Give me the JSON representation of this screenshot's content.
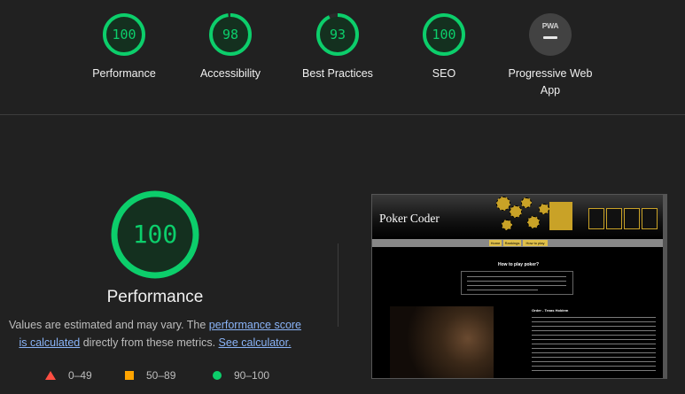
{
  "top_scores": [
    {
      "score": "100",
      "label": "Performance",
      "fraction": 1.0,
      "color": "#0cce6b"
    },
    {
      "score": "98",
      "label": "Accessibility",
      "fraction": 0.98,
      "color": "#0cce6b"
    },
    {
      "score": "93",
      "label": "Best Practices",
      "fraction": 0.93,
      "color": "#0cce6b"
    },
    {
      "score": "100",
      "label": "SEO",
      "fraction": 1.0,
      "color": "#0cce6b"
    }
  ],
  "pwa": {
    "badge_text": "PWA",
    "label_line1": "Progressive Web",
    "label_line2": "App"
  },
  "main": {
    "score": "100",
    "fraction": 1.0,
    "title": "Performance",
    "desc_part1": "Values are estimated and may vary. The ",
    "desc_link1": "performance score is calculated",
    "desc_part2": " directly from these metrics. ",
    "desc_link2": "See calculator."
  },
  "legend": [
    {
      "range": "0–49",
      "color": "#ff4e42"
    },
    {
      "range": "50–89",
      "color": "#ffa400"
    },
    {
      "range": "90–100",
      "color": "#0cce6b"
    }
  ],
  "screenshot": {
    "site_title": "Poker Coder",
    "nav": [
      "Home",
      "Rankings",
      "How to play"
    ],
    "heading": "How to play poker?",
    "side_heading": "Order - Texas Holdem"
  }
}
